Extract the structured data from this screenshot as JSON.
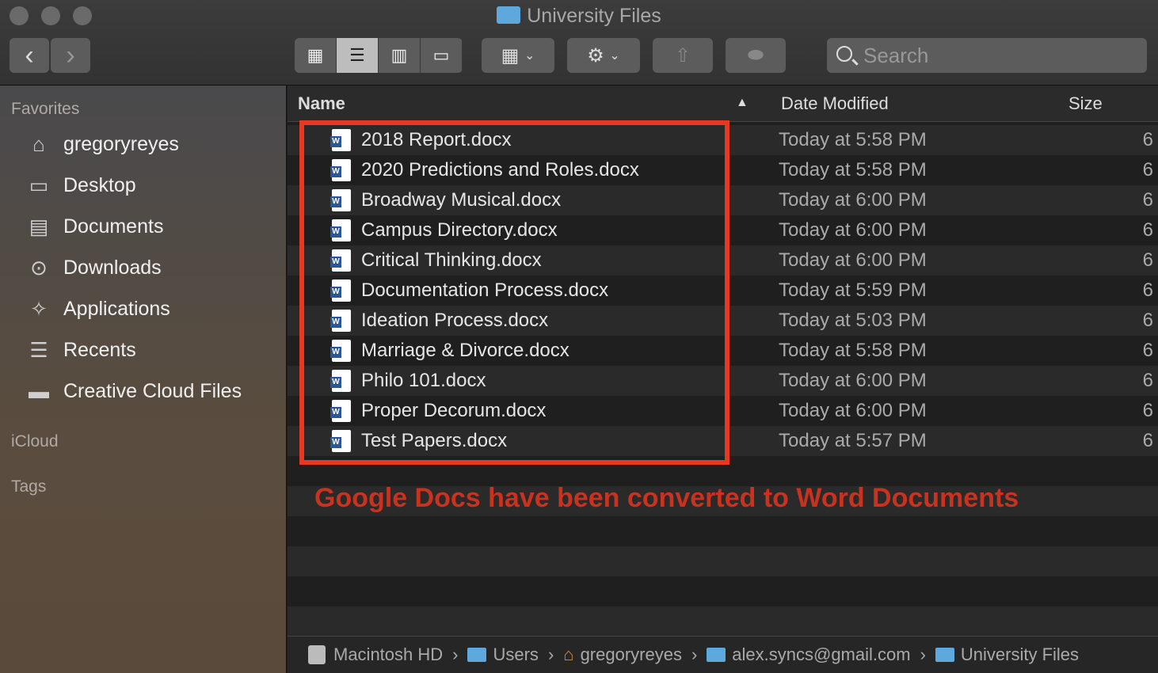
{
  "window": {
    "title": "University Files"
  },
  "toolbar": {
    "back": "‹",
    "forward": "›",
    "search_placeholder": "Search"
  },
  "sidebar": {
    "favorites_header": "Favorites",
    "items": [
      {
        "label": "gregoryreyes",
        "icon": "home-icon",
        "glyph": "⌂"
      },
      {
        "label": "Desktop",
        "icon": "desktop-icon",
        "glyph": "▭"
      },
      {
        "label": "Documents",
        "icon": "documents-icon",
        "glyph": "▤"
      },
      {
        "label": "Downloads",
        "icon": "downloads-icon",
        "glyph": "⊙"
      },
      {
        "label": "Applications",
        "icon": "applications-icon",
        "glyph": "✧"
      },
      {
        "label": "Recents",
        "icon": "recents-icon",
        "glyph": "☰"
      },
      {
        "label": "Creative Cloud Files",
        "icon": "folder-icon",
        "glyph": "▬"
      }
    ],
    "icloud_header": "iCloud",
    "tags_header": "Tags"
  },
  "columns": {
    "name": "Name",
    "date": "Date Modified",
    "size": "Size"
  },
  "files": [
    {
      "name": "2018 Report.docx",
      "date": "Today at 5:58 PM",
      "size": "6"
    },
    {
      "name": "2020 Predictions and Roles.docx",
      "date": "Today at 5:58 PM",
      "size": "6"
    },
    {
      "name": "Broadway Musical.docx",
      "date": "Today at 6:00 PM",
      "size": "6"
    },
    {
      "name": "Campus Directory.docx",
      "date": "Today at 6:00 PM",
      "size": "6"
    },
    {
      "name": "Critical Thinking.docx",
      "date": "Today at 6:00 PM",
      "size": "6"
    },
    {
      "name": "Documentation Process.docx",
      "date": "Today at 5:59 PM",
      "size": "6"
    },
    {
      "name": "Ideation Process.docx",
      "date": "Today at 5:03 PM",
      "size": "6"
    },
    {
      "name": "Marriage & Divorce.docx",
      "date": "Today at 5:58 PM",
      "size": "6"
    },
    {
      "name": "Philo 101.docx",
      "date": "Today at 6:00 PM",
      "size": "6"
    },
    {
      "name": "Proper Decorum.docx",
      "date": "Today at 6:00 PM",
      "size": "6"
    },
    {
      "name": "Test Papers.docx",
      "date": "Today at 5:57 PM",
      "size": "6"
    }
  ],
  "annotation": {
    "text": "Google Docs have been converted to Word Documents",
    "color": "#c8321f",
    "box_color": "#e53a22"
  },
  "path": [
    "Macintosh HD",
    "Users",
    "gregoryreyes",
    "alex.syncs@gmail.com",
    "University Files"
  ]
}
